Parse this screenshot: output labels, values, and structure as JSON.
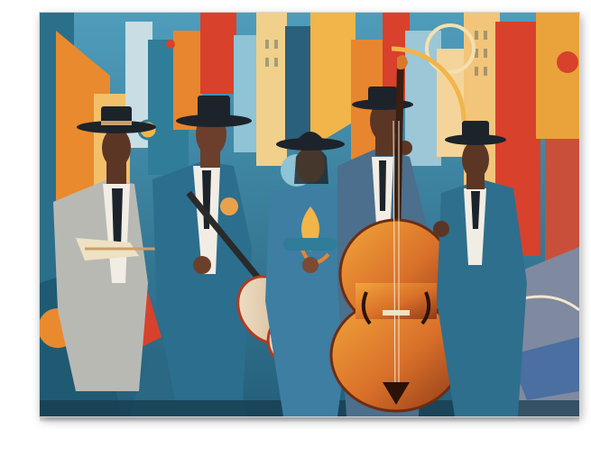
{
  "image": {
    "subject": "canvas-print",
    "palette": {
      "background": "#ffffff",
      "teal": "#2f7d99",
      "sky": "#8fc3d6",
      "orange": "#e7862e",
      "gold": "#f1b54a",
      "red": "#d8412c",
      "cream": "#efe1c4",
      "charcoal": "#1d232b",
      "skin": "#7a4a35",
      "wood": "#d9782a"
    }
  }
}
